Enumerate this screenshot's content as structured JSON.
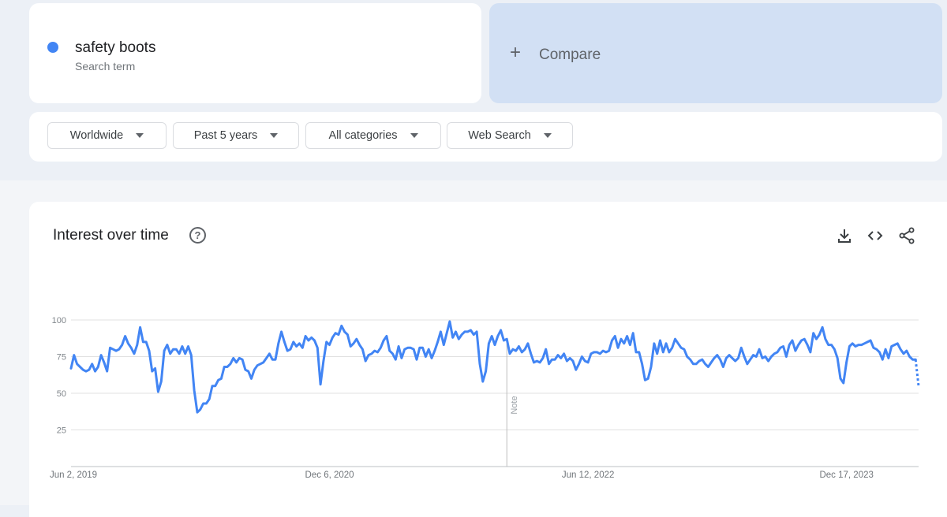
{
  "search_term": {
    "name": "safety boots",
    "type_label": "Search term",
    "color": "#4285f4"
  },
  "compare": {
    "plus": "+",
    "label": "Compare"
  },
  "filters": [
    {
      "label": "Worldwide"
    },
    {
      "label": "Past 5 years"
    },
    {
      "label": "All categories"
    },
    {
      "label": "Web Search"
    }
  ],
  "chart_panel": {
    "title": "Interest over time",
    "help_icon": "?",
    "tools": [
      "download-icon",
      "embed-icon",
      "share-icon"
    ]
  },
  "chart_data": {
    "type": "line",
    "title": "Interest over time",
    "series": [
      {
        "values": [
          67,
          76,
          70,
          68,
          66,
          65,
          66,
          70,
          65,
          68,
          76,
          71,
          65,
          81,
          80,
          79,
          80,
          83,
          89,
          84,
          81,
          77,
          83,
          95,
          85,
          85,
          79,
          65,
          67,
          51,
          58,
          79,
          83,
          77,
          80,
          80,
          77,
          82,
          77,
          82,
          76,
          52,
          37,
          39,
          43,
          43,
          46,
          55,
          55,
          59,
          60,
          68,
          68,
          70,
          74,
          71,
          74,
          73,
          66,
          65,
          60,
          66,
          69,
          70,
          71,
          74,
          77,
          73,
          73,
          84,
          92,
          85,
          79,
          80,
          85,
          82,
          84,
          81,
          89,
          86,
          88,
          86,
          81,
          56,
          72,
          85,
          83,
          88,
          91,
          90,
          96,
          92,
          90,
          82,
          84,
          87,
          83,
          80,
          72,
          76,
          77,
          79,
          78,
          81,
          86,
          89,
          79,
          77,
          73,
          82,
          74,
          80,
          81,
          81,
          80,
          73,
          81,
          81,
          75,
          80,
          74,
          79,
          85,
          92,
          83,
          91,
          99,
          88,
          92,
          87,
          90,
          92,
          92,
          93,
          90,
          92,
          70,
          58,
          65,
          84,
          89,
          83,
          89,
          93,
          86,
          87,
          77,
          80,
          79,
          82,
          78,
          80,
          84,
          77,
          71,
          72,
          71,
          74,
          80,
          70,
          73,
          73,
          76,
          74,
          77,
          72,
          74,
          72,
          66,
          70,
          75,
          72,
          71,
          77,
          78,
          78,
          77,
          79,
          78,
          79,
          86,
          89,
          81,
          87,
          84,
          89,
          83,
          91,
          78,
          78,
          70,
          59,
          60,
          68,
          84,
          77,
          86,
          78,
          84,
          78,
          81,
          87,
          84,
          81,
          80,
          75,
          73,
          70,
          70,
          72,
          73,
          70,
          68,
          71,
          74,
          76,
          73,
          68,
          74,
          76,
          74,
          72,
          74,
          81,
          75,
          70,
          73,
          76,
          75,
          80,
          74,
          75,
          72,
          75,
          77,
          78,
          81,
          82,
          75,
          83,
          86,
          79,
          83,
          86,
          87,
          83,
          78,
          91,
          87,
          90,
          95,
          87,
          83,
          83,
          80,
          74,
          60,
          57,
          71,
          82,
          84,
          82,
          83,
          83,
          84,
          85,
          86,
          81,
          80,
          78,
          73,
          80,
          74,
          82,
          83,
          84,
          80,
          77,
          79,
          75,
          73,
          73,
          55
        ]
      }
    ],
    "partial_last_point": true,
    "ylim": [
      0,
      100
    ],
    "yticks": [
      100,
      75,
      50,
      25
    ],
    "xtick_labels": [
      "Jun 2, 2019",
      "Dec 6, 2020",
      "Jun 12, 2022",
      "Dec 17, 2023"
    ],
    "note": {
      "label": "Note",
      "at_index": 145
    },
    "grid": true,
    "line_color": "#4285f4"
  }
}
